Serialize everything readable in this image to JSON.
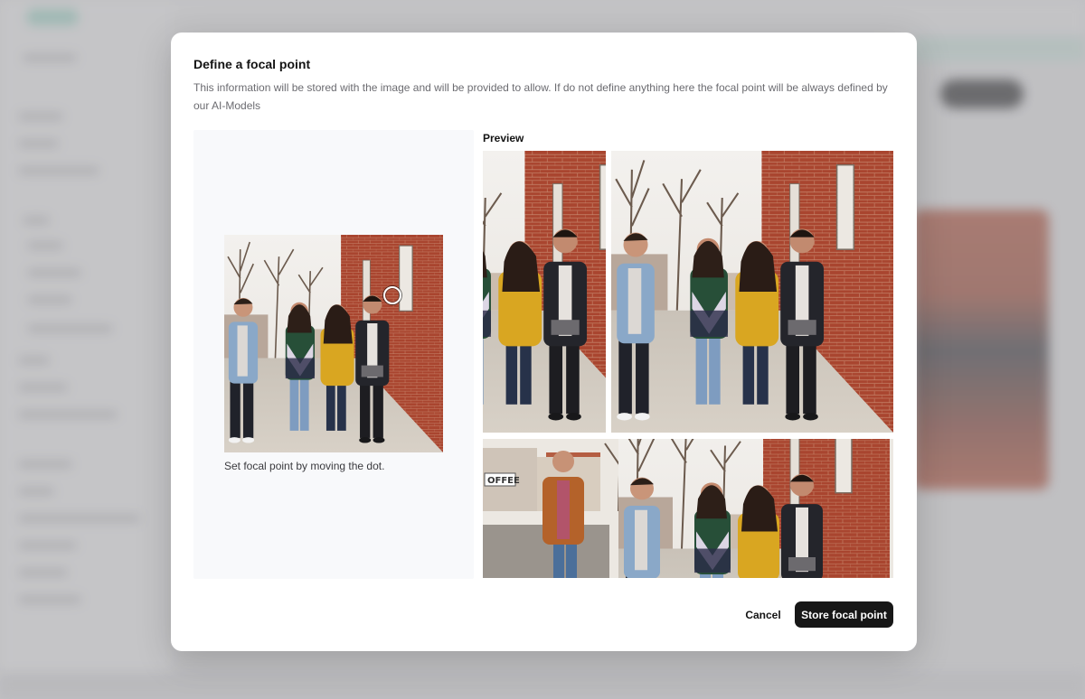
{
  "dialog": {
    "title": "Define a focal point",
    "description": "This information will be stored with the image and will be provided to allow. If do not define anything here the focal point will be always defined by our AI-Models",
    "hint": "Set focal point by moving the dot.",
    "preview_label": "Preview",
    "cancel_label": "Cancel",
    "submit_label": "Store focal point"
  },
  "photo": {
    "storefront_sign": "OFFEE"
  },
  "colors": {
    "primary_button": "#171717",
    "panel_bg": "#f8f9fb",
    "brick": "#a9452f",
    "accent_teal": "#9fd6c8"
  }
}
